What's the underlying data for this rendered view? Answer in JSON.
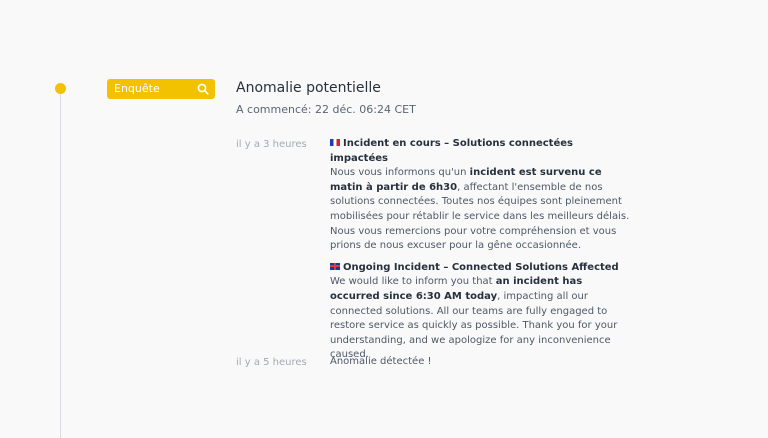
{
  "incident": {
    "status": "Enquête",
    "title": "Anomalie potentielle",
    "started": "A commencé: 22 déc. 06:24 CET"
  },
  "updates": [
    {
      "time": "il y a 3 heures",
      "fr": {
        "title": "Incident en cours – Solutions connectées impactées",
        "t1": "Nous vous informons qu'un ",
        "b1": "incident est survenu ce matin à partir de 6h30",
        "t2": ", affectant l'ensemble de nos solutions connectées. Toutes nos équipes sont pleinement mobilisées pour rétablir le service dans les meilleurs délais. Nous vous remercions pour votre compréhension et vous prions de nous excuser pour la gêne occasionnée."
      },
      "en": {
        "title": "Ongoing Incident – Connected Solutions Affected",
        "t1": " We would like to inform you that ",
        "b1": "an incident has occurred since 6:30 AM today",
        "t2": ", impacting all our connected solutions. All our teams are fully engaged to restore service as quickly as possible. Thank you for your understanding, and we apologize for any inconvenience caused."
      }
    },
    {
      "time": "il y a 5 heures",
      "text": "Anomalie détectée !"
    }
  ],
  "colors": {
    "accent": "#f2c200",
    "timeline": "#d9dde3",
    "text": "#27313d"
  },
  "icons": {
    "status": "search-icon",
    "fr_flag": "flag-fr-icon",
    "uk_flag": "flag-uk-icon"
  }
}
